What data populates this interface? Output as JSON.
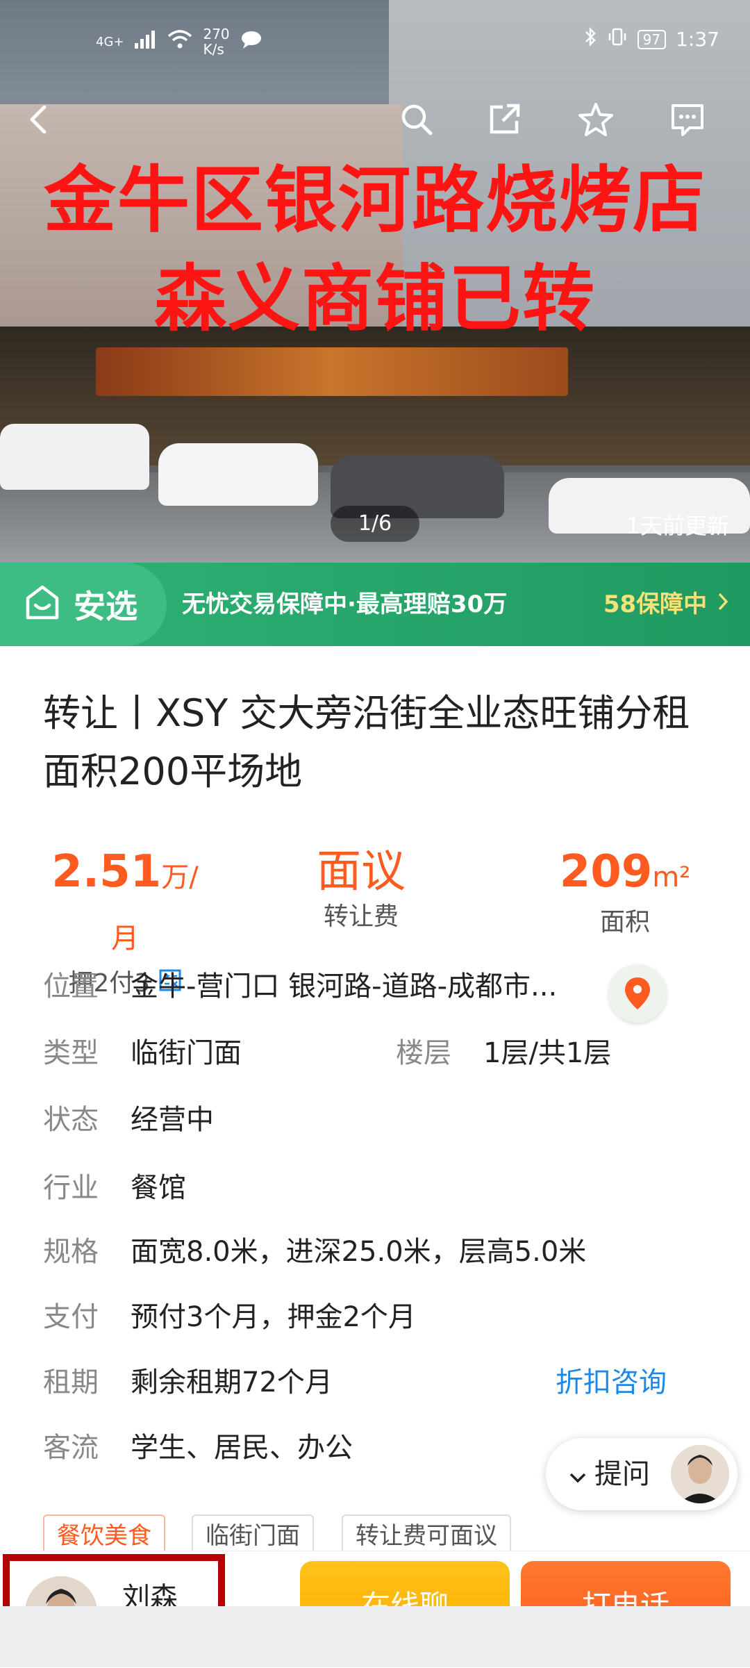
{
  "status_bar": {
    "network": "4G+",
    "speed_value": "270",
    "speed_unit": "K/s",
    "battery": "97",
    "time": "1:37"
  },
  "photo": {
    "overlay_line1": "金牛区银河路烧烤店",
    "overlay_line2": "森义商铺已转",
    "counter": "1/6",
    "updated": "1天前更新"
  },
  "banner": {
    "badge": "安选",
    "text": "无忧交易保障中·最高理赔30万",
    "link": "58保障中"
  },
  "listing": {
    "title": "转让丨XSY 交大旁沿街全业态旺铺分租面积200平场地"
  },
  "stats": {
    "rent_value": "2.51",
    "rent_unit": "万/月",
    "rent_label": "押2付3",
    "fee_value": "面议",
    "fee_label": "转让费",
    "area_value": "209",
    "area_unit": "m²",
    "area_label": "面积"
  },
  "details": {
    "location_key": "位置",
    "location_value": "金牛-营门口 银河路-道路-成都市...",
    "type_key": "类型",
    "type_value": "临街门面",
    "floor_key": "楼层",
    "floor_value": "1层/共1层",
    "status_key": "状态",
    "status_value": "经营中",
    "industry_key": "行业",
    "industry_value": "餐馆",
    "spec_key": "规格",
    "spec_value": "面宽8.0米，进深25.0米，层高5.0米",
    "pay_key": "支付",
    "pay_value": "预付3个月，押金2个月",
    "lease_key": "租期",
    "lease_value": "剩余租期72个月",
    "lease_link": "折扣咨询",
    "traffic_key": "客流",
    "traffic_value": "学生、居民、办公"
  },
  "ask": {
    "label": "提问"
  },
  "tags": [
    "餐饮美食",
    "临街门面",
    "转让费可面议"
  ],
  "bottom": {
    "agent_name": "刘森",
    "chat": "在线聊",
    "call": "打电话"
  },
  "colors": {
    "accent_orange": "#ff5a1f",
    "safe_green": "#2fb276",
    "link_blue": "#1e88e5",
    "overlay_red": "#ff1414"
  }
}
